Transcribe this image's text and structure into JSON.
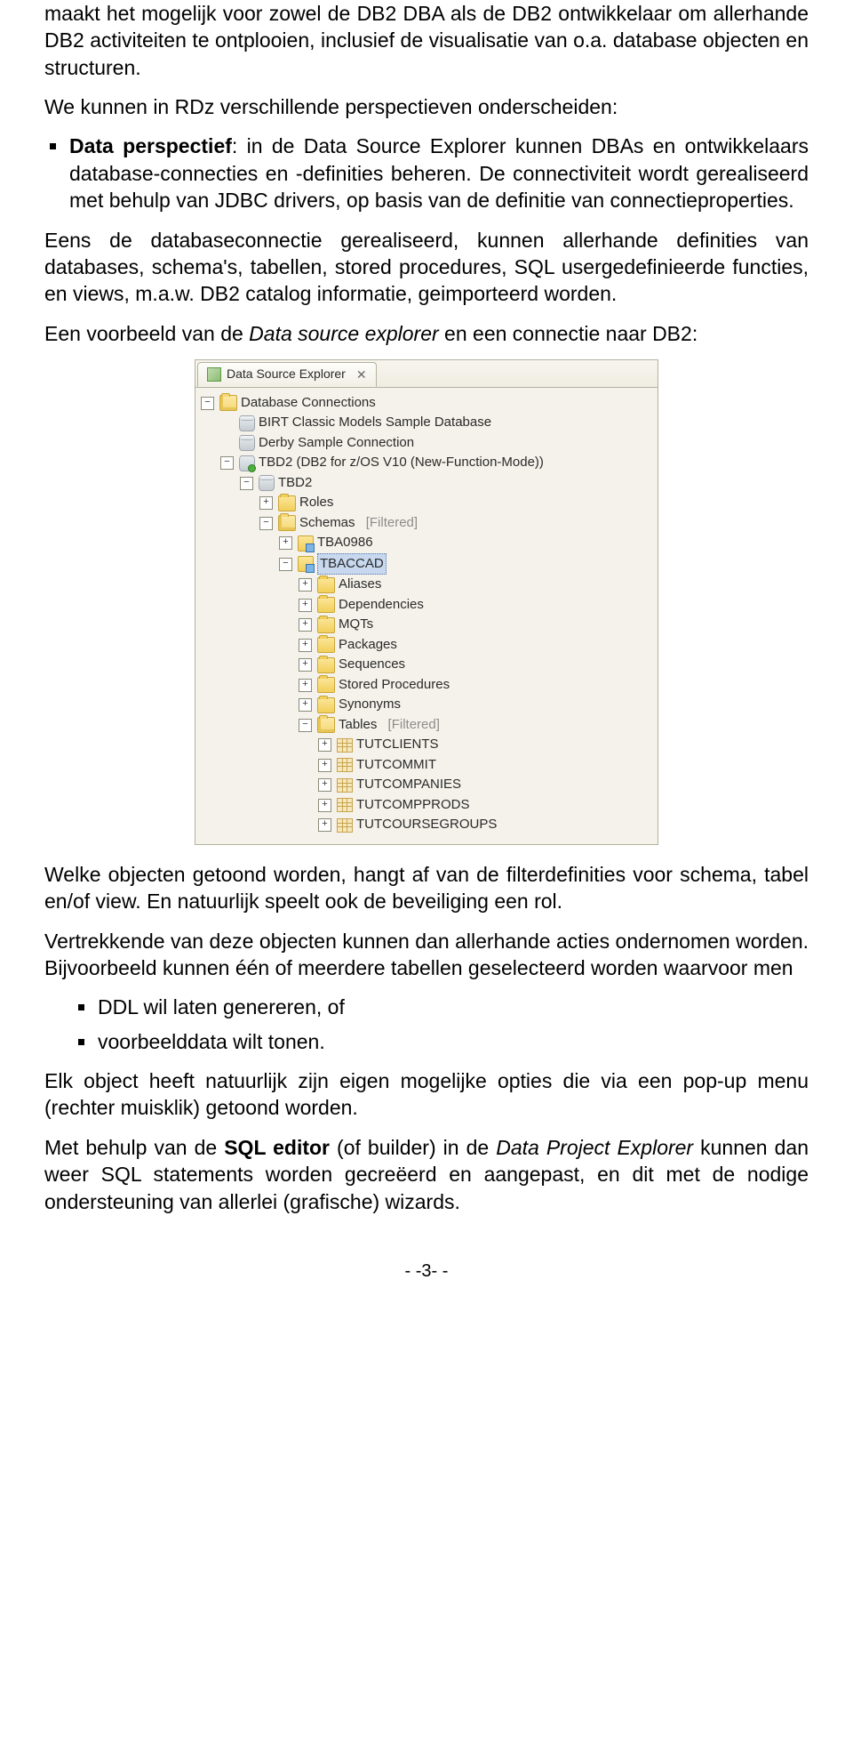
{
  "paragraphs": {
    "p1": "maakt het mogelijk voor zowel de DB2 DBA als de DB2 ontwikkelaar om allerhande DB2 activiteiten te ontplooien, inclusief de visualisatie van o.a. database objecten en structuren.",
    "p2": "We kunnen in RDz verschillende perspectieven onderscheiden:",
    "p3_label": "Data perspectief",
    "p3_rest": ": in de Data Source Explorer kunnen DBAs en ontwikkelaars database-connecties en -definities beheren. De connectiviteit wordt gerealiseerd met behulp van JDBC drivers, op basis van de definitie van connectieproperties.",
    "p4": "Eens de databaseconnectie gerealiseerd, kunnen allerhande definities van databases, schema's, tabellen, stored procedures, SQL usergedefinieerde functies, en views, m.a.w. DB2 catalog informatie, geimporteerd worden.",
    "p5a": "Een voorbeeld van de ",
    "p5i": "Data source explorer",
    "p5b": " en een connectie naar DB2:",
    "p6": "Welke objecten getoond worden, hangt af van de filterdefinities voor schema, tabel en/of view. En natuurlijk speelt ook de beveiliging een rol.",
    "p7": "Vertrekkende van deze objecten kunnen dan allerhande acties ondernomen worden. Bijvoorbeeld kunnen één of meerdere tabellen geselecteerd worden waarvoor men",
    "p7_li1": "DDL wil laten genereren, of",
    "p7_li2": "voorbeelddata wilt tonen.",
    "p8": "Elk object heeft natuurlijk zijn eigen mogelijke opties die via een pop-up menu (rechter muisklik) getoond worden.",
    "p9a": "Met behulp van de ",
    "p9b": "SQL editor",
    "p9c": " (of builder) in de ",
    "p9i": "Data Project Explorer",
    "p9d": " kunnen dan weer SQL statements worden gecreëerd en aangepast, en dit met de nodige ondersteuning van allerlei (grafische) wizards."
  },
  "explorer": {
    "tab_title": "Data Source Explorer",
    "root": "Database Connections",
    "conn1": "BIRT Classic Models Sample Database",
    "conn2": "Derby Sample Connection",
    "conn3": "TBD2 (DB2 for z/OS V10 (New-Function-Mode))",
    "db": "TBD2",
    "roles": "Roles",
    "schemas": "Schemas",
    "filtered": "[Filtered]",
    "schema1": "TBA0986",
    "schema2": "TBACCAD",
    "f_aliases": "Aliases",
    "f_deps": "Dependencies",
    "f_mqts": "MQTs",
    "f_pkgs": "Packages",
    "f_seqs": "Sequences",
    "f_sps": "Stored Procedures",
    "f_syn": "Synonyms",
    "f_tables": "Tables",
    "t1": "TUTCLIENTS",
    "t2": "TUTCOMMIT",
    "t3": "TUTCOMPANIES",
    "t4": "TUTCOMPPRODS",
    "t5": "TUTCOURSEGROUPS"
  },
  "footer": "- -3- -"
}
